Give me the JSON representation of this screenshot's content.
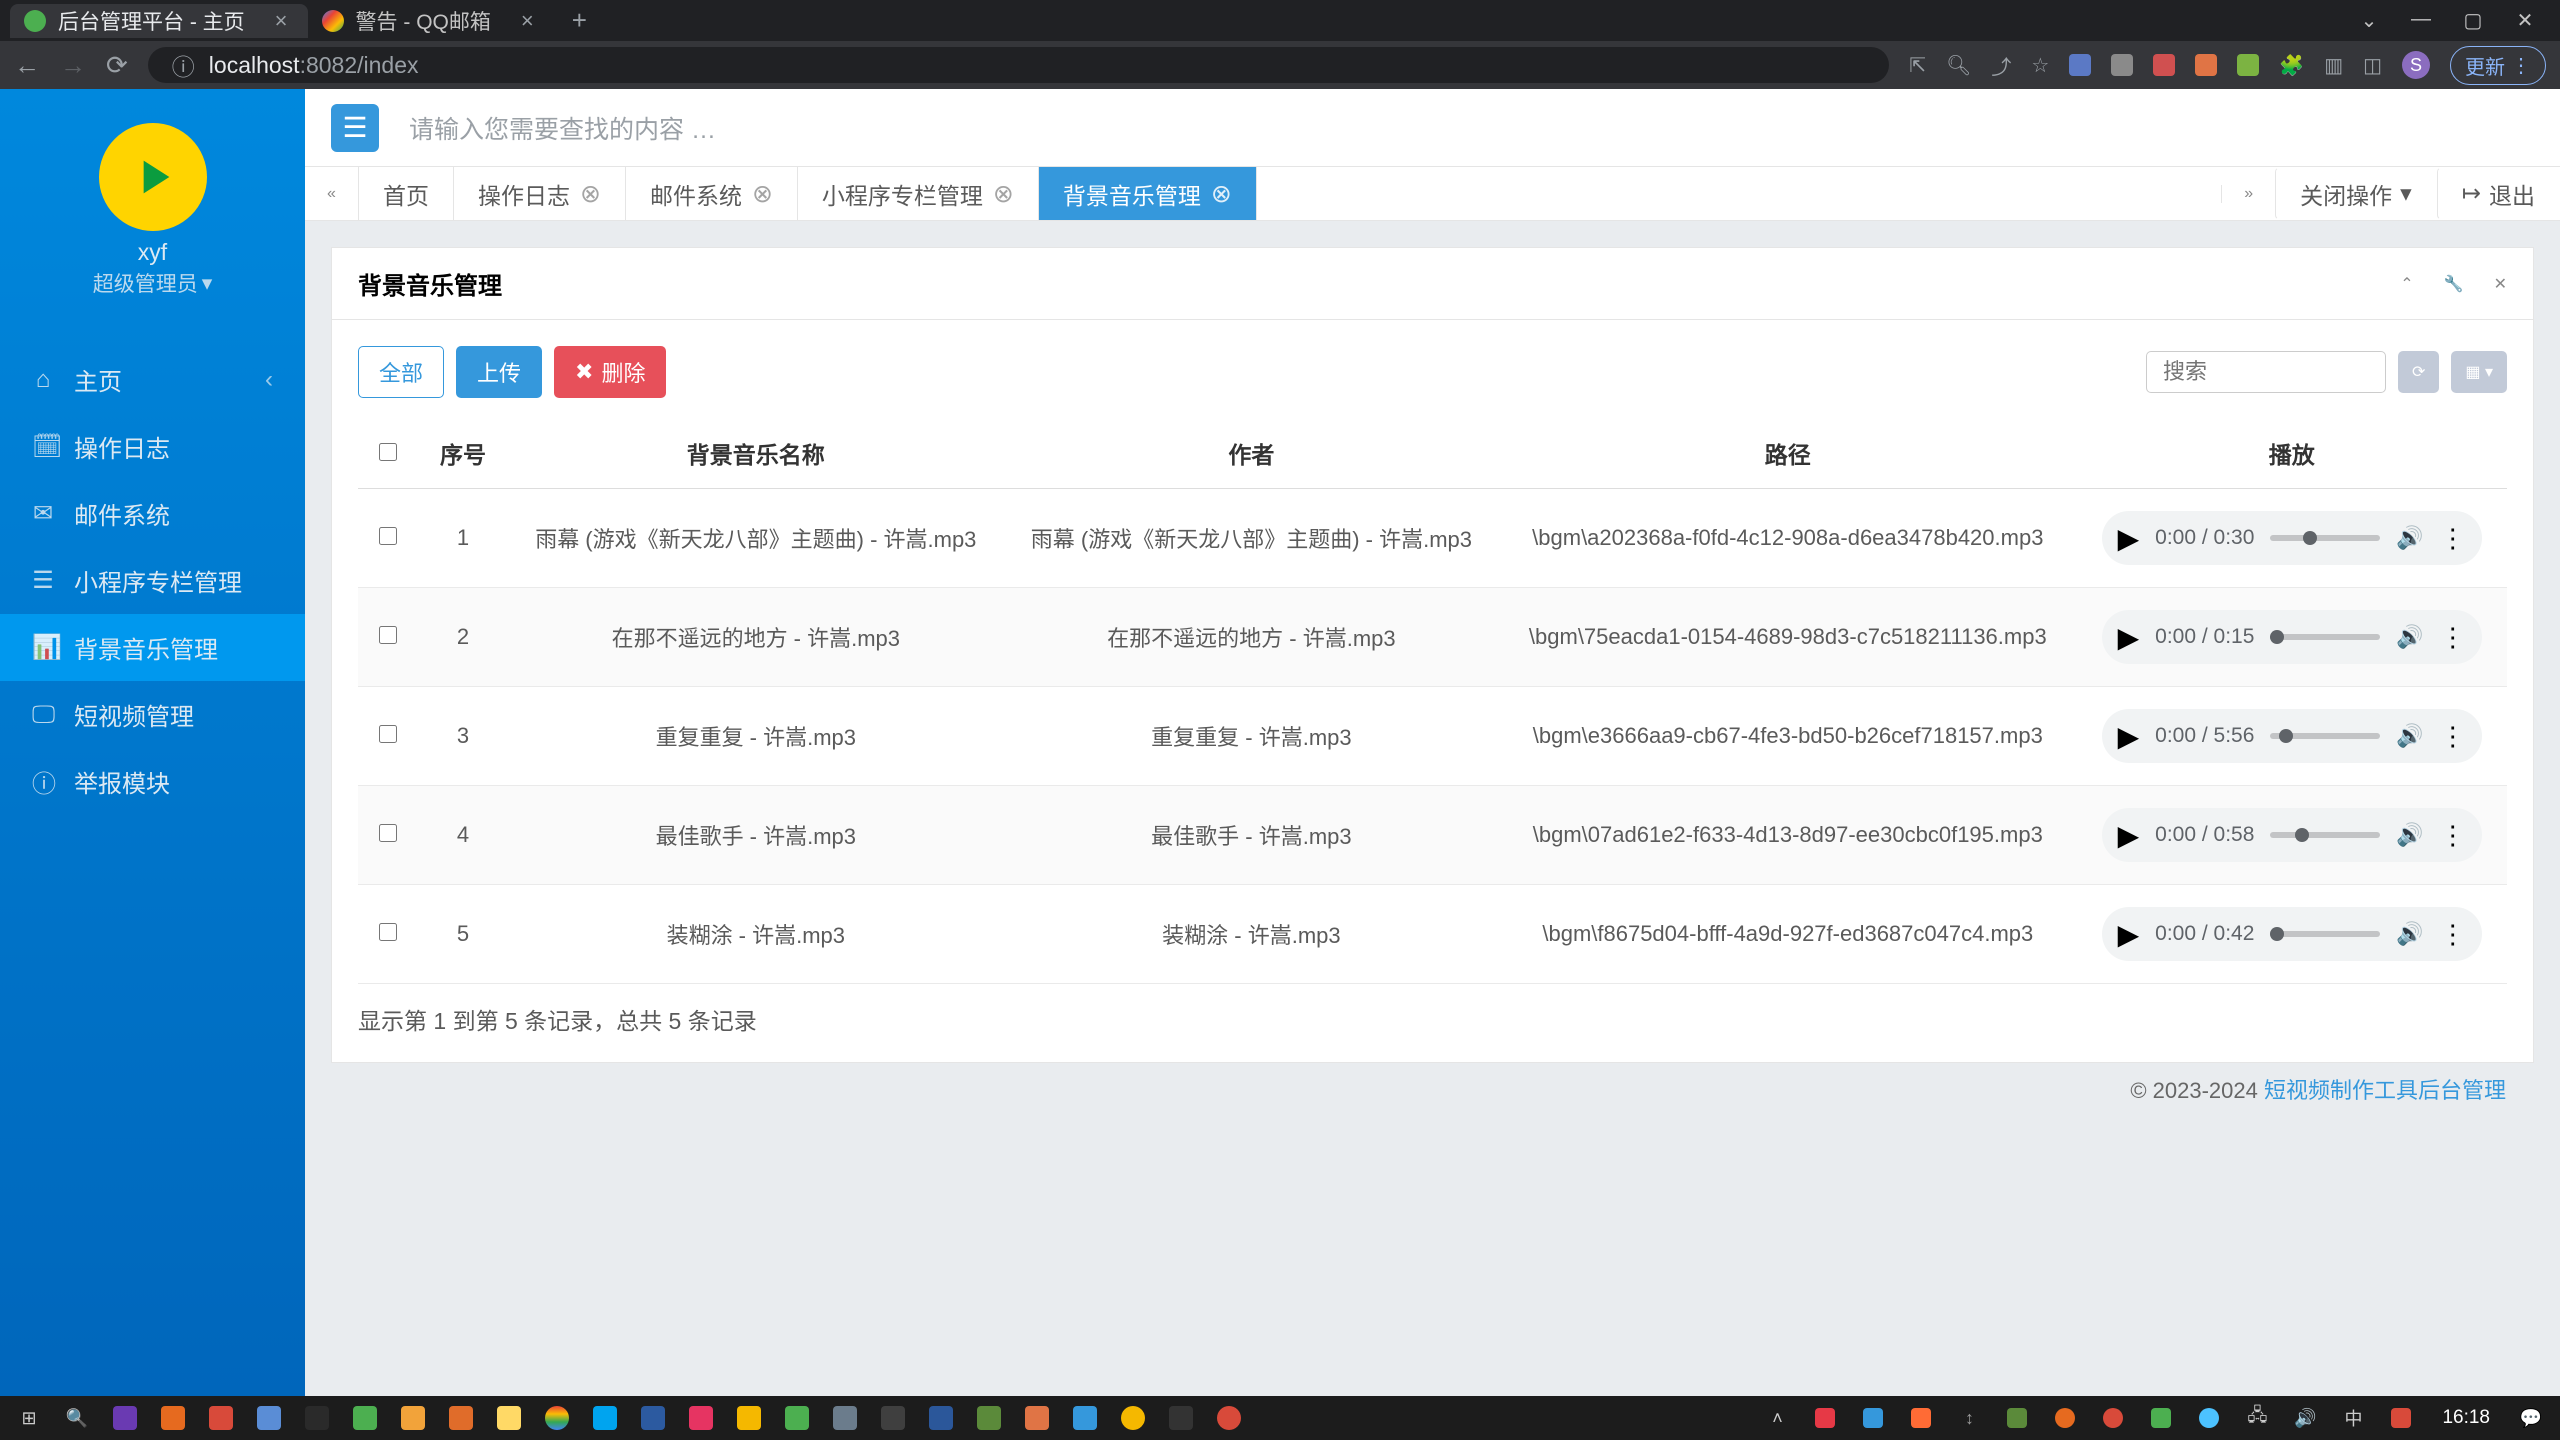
{
  "browser": {
    "tabs": [
      {
        "label": "后台管理平台 - 主页",
        "active": true
      },
      {
        "label": "警告 - QQ邮箱",
        "active": false
      }
    ],
    "url_prefix": "localhost",
    "url_rest": ":8082/index",
    "update_label": "更新"
  },
  "sidebar": {
    "user": "xyf",
    "role": "超级管理员",
    "items": [
      {
        "icon": "⌂",
        "label": "主页",
        "has_children": true
      },
      {
        "icon": "🗓",
        "label": "操作日志"
      },
      {
        "icon": "✉",
        "label": "邮件系统"
      },
      {
        "icon": "☰",
        "label": "小程序专栏管理"
      },
      {
        "icon": "📊",
        "label": "背景音乐管理",
        "active": true
      },
      {
        "icon": "🖵",
        "label": "短视频管理"
      },
      {
        "icon": "ⓘ",
        "label": "举报模块"
      }
    ]
  },
  "topbar": {
    "search_placeholder": "请输入您需要查找的内容 …"
  },
  "tabs": {
    "items": [
      {
        "label": "首页",
        "closable": false
      },
      {
        "label": "操作日志",
        "closable": true
      },
      {
        "label": "邮件系统",
        "closable": true
      },
      {
        "label": "小程序专栏管理",
        "closable": true
      },
      {
        "label": "背景音乐管理",
        "closable": true,
        "active": true
      }
    ],
    "close_ops": "关闭操作",
    "logout": "退出"
  },
  "panel": {
    "title": "背景音乐管理",
    "btn_all": "全部",
    "btn_upload": "上传",
    "btn_delete": "删除",
    "search_placeholder": "搜索",
    "columns": [
      "",
      "序号",
      "背景音乐名称",
      "作者",
      "路径",
      "播放"
    ],
    "rows": [
      {
        "seq": 1,
        "name": "雨幕 (游戏《新天龙八部》主题曲) - 许嵩.mp3",
        "author": "雨幕 (游戏《新天龙八部》主题曲) - 许嵩.mp3",
        "path": "\\bgm\\a202368a-f0fd-4c12-908a-d6ea3478b420.mp3",
        "dur": "0:30",
        "progress": 0.3
      },
      {
        "seq": 2,
        "name": "在那不遥远的地方 - 许嵩.mp3",
        "author": "在那不遥远的地方 - 许嵩.mp3",
        "path": "\\bgm\\75eacda1-0154-4689-98d3-c7c518211136.mp3",
        "dur": "0:15",
        "progress": 0
      },
      {
        "seq": 3,
        "name": "重复重复 - 许嵩.mp3",
        "author": "重复重复 - 许嵩.mp3",
        "path": "\\bgm\\e3666aa9-cb67-4fe3-bd50-b26cef718157.mp3",
        "dur": "5:56",
        "progress": 0.08
      },
      {
        "seq": 4,
        "name": "最佳歌手 - 许嵩.mp3",
        "author": "最佳歌手 - 许嵩.mp3",
        "path": "\\bgm\\07ad61e2-f633-4d13-8d97-ee30cbc0f195.mp3",
        "dur": "0:58",
        "progress": 0.22
      },
      {
        "seq": 5,
        "name": "装糊涂 - 许嵩.mp3",
        "author": "装糊涂 - 许嵩.mp3",
        "path": "\\bgm\\f8675d04-bfff-4a9d-927f-ed3687c047c4.mp3",
        "dur": "0:42",
        "progress": 0
      }
    ],
    "summary": "显示第 1 到第 5 条记录，总共 5 条记录"
  },
  "footer": {
    "copyright": "© 2023-2024 ",
    "link": "短视频制作工具后台管理"
  },
  "taskbar": {
    "time": "16:18"
  }
}
